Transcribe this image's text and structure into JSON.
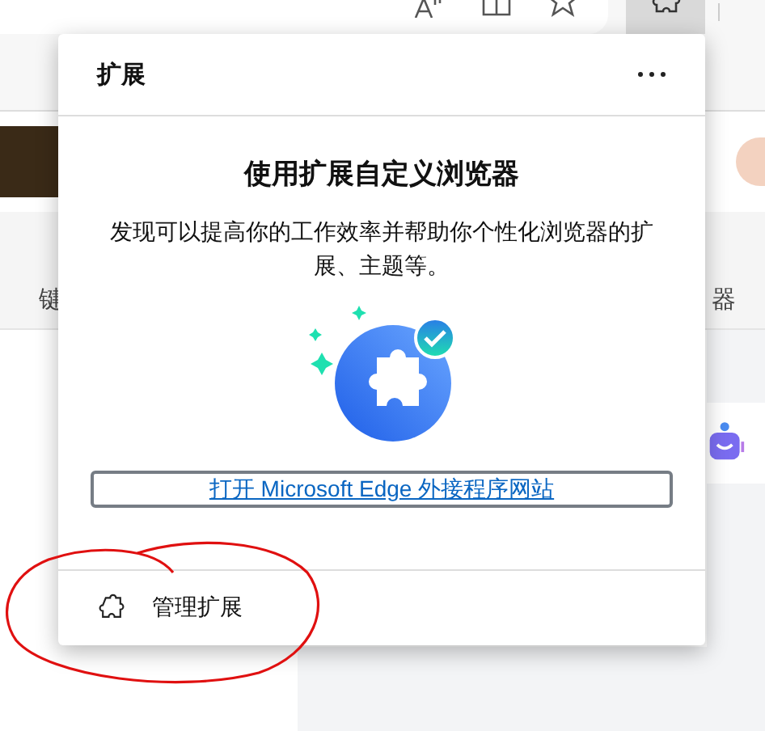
{
  "toolbar": {
    "extensions_button": {
      "selected": true
    }
  },
  "background_page": {
    "left_fragment": "键",
    "right_fragment": "器"
  },
  "popup": {
    "title": "扩展",
    "heading": "使用扩展自定义浏览器",
    "description": "发现可以提高你的工作效率并帮助你个性化浏览器的扩展、主题等。",
    "link": "打开 Microsoft Edge 外接程序网站",
    "footer_item": {
      "label": "管理扩展"
    }
  }
}
